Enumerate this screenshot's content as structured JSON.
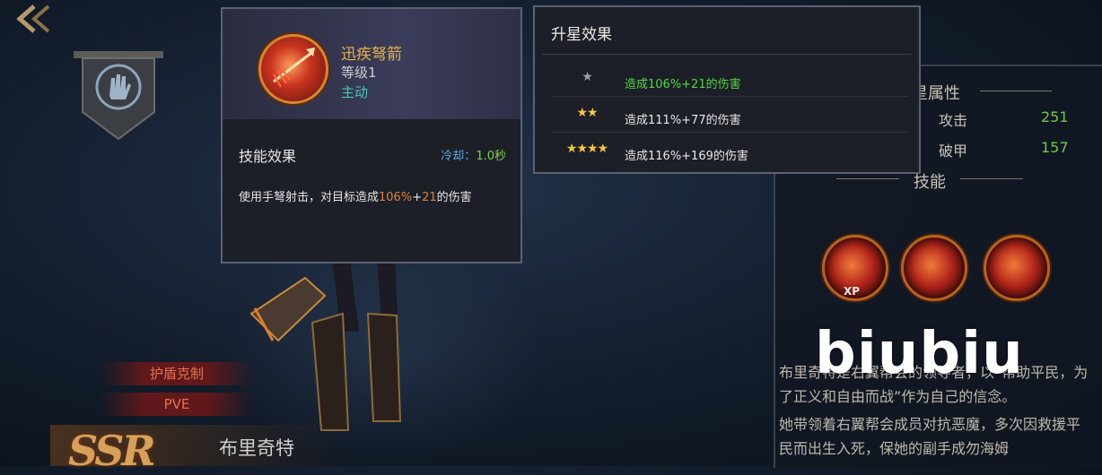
{
  "skill_popup": {
    "name": "迅疾弩箭",
    "level": "等级1",
    "type": "主动",
    "effect_title": "技能效果",
    "cooldown_label": "冷却：",
    "cooldown_value": "1.0秒",
    "desc_prefix": "使用手弩射击，对目标造成",
    "desc_pct": "106%",
    "desc_plus": "+",
    "desc_flat": "21",
    "desc_suffix": "的伤害"
  },
  "star_popup": {
    "title": "升星效果",
    "rows": [
      {
        "stars": "★",
        "text": "造成106%+21的伤害",
        "active": true
      },
      {
        "stars": "★★",
        "text": "造成111%+77的伤害",
        "active": false
      },
      {
        "stars": "★★★★",
        "text": "造成116%+169的伤害",
        "active": false
      }
    ]
  },
  "right_panel": {
    "attr_header": "星属性",
    "stats": [
      {
        "label": "攻击",
        "value": "251"
      },
      {
        "label": "破甲",
        "value": "157"
      }
    ],
    "skills_header": "技能",
    "xp_label": "XP",
    "bio": [
      "布里奇特是右翼帮会的领导者，以“帮助平民，为了正义和自由而战”作为自己的信念。",
      "她带领着右翼帮会成员对抗恶魔，多次因救援平民而出生入死，保她的副手成勿海姆"
    ]
  },
  "hero": {
    "tags": [
      "护盾克制",
      "PVE"
    ],
    "rarity": "SSR",
    "name": "布里奇特"
  },
  "watermark": "biubiu",
  "colors": {
    "active_green": "#52d640",
    "stat_green": "#6ec84b",
    "gold": "#e8b14a",
    "cooldown_blue": "#5fa8e0"
  }
}
